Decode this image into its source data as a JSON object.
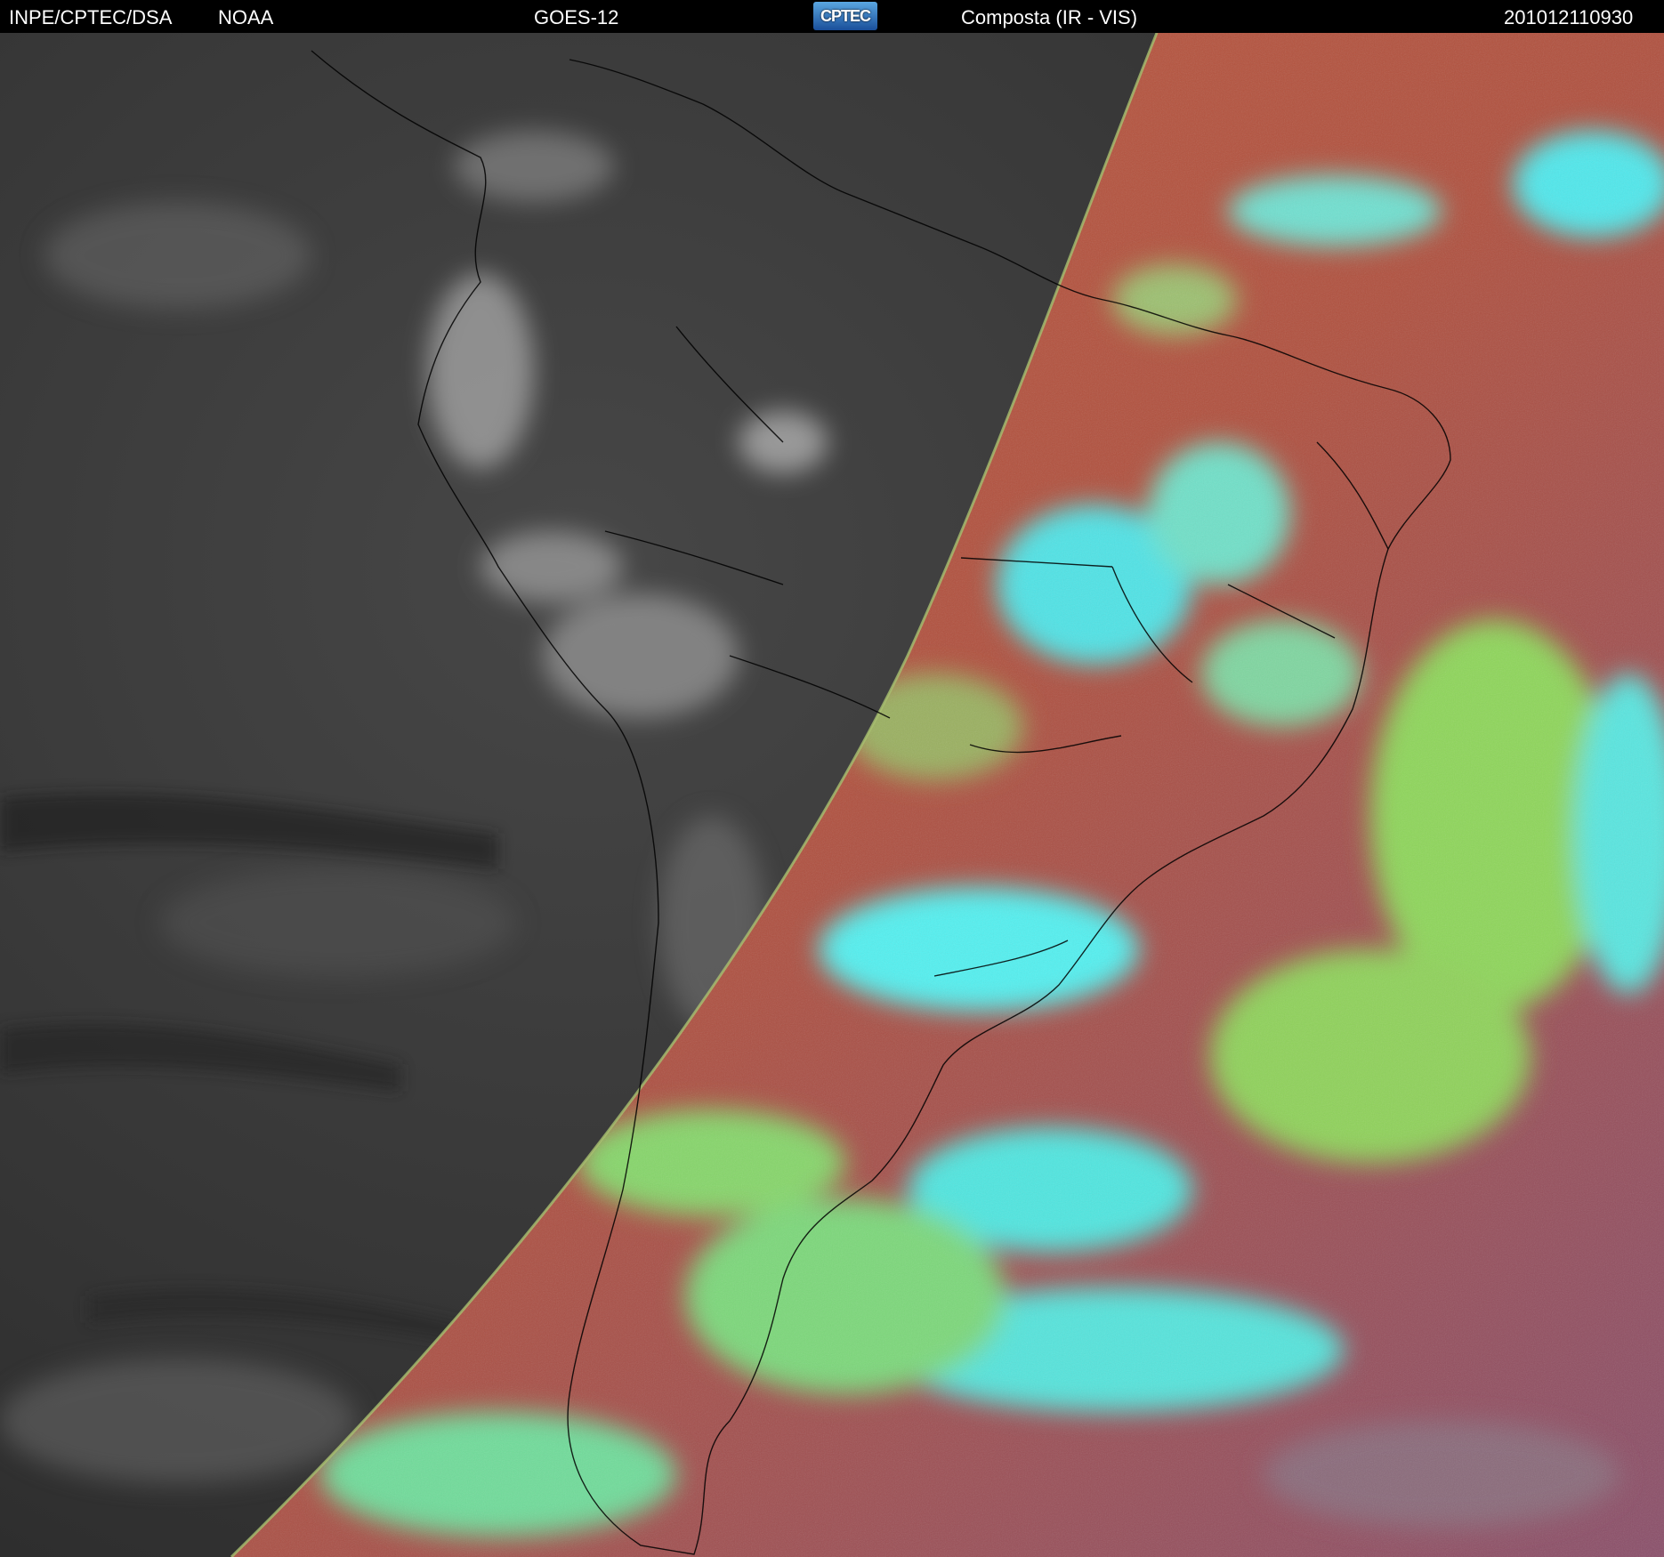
{
  "header": {
    "agency": "INPE/CPTEC/DSA",
    "source": "NOAA",
    "satellite": "GOES-12",
    "logo_text": "CPTEC",
    "product": "Composta (IR - VIS)",
    "timestamp": "201012110930"
  },
  "colors": {
    "background": "#000000",
    "header_text": "#ffffff",
    "night_side": "#3a3a3a",
    "day_ocean": "#b8523e",
    "cloud_cyan": "#3fe8e8",
    "cloud_green": "#8fd45a",
    "coastline": "#000000"
  },
  "icons": [
    "cptec-logo"
  ]
}
